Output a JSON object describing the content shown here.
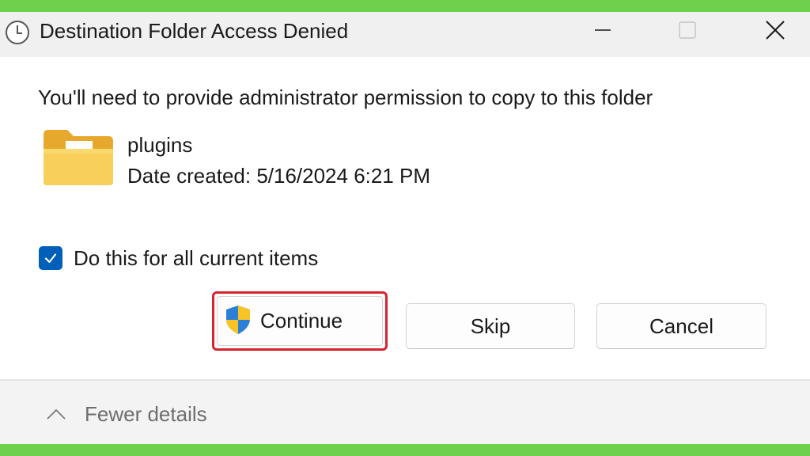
{
  "window": {
    "title": "Destination Folder Access Denied",
    "controls": [
      "minimize-icon",
      "maximize-icon",
      "close-icon"
    ]
  },
  "dialog": {
    "message": "You'll need to provide administrator permission to copy to this folder",
    "item": {
      "icon": "folder-icon",
      "name": "plugins",
      "date_created": "Date created: 5/16/2024 6:21 PM"
    },
    "checkbox": {
      "label": "Do this for all current items",
      "checked": true
    },
    "buttons": {
      "continue": "Continue",
      "skip": "Skip",
      "cancel": "Cancel"
    },
    "footer": {
      "toggle_label": "Fewer details"
    }
  },
  "colors": {
    "accent": "#005fb8",
    "highlight": "#d6232e",
    "border_frame": "#6fd14b"
  }
}
